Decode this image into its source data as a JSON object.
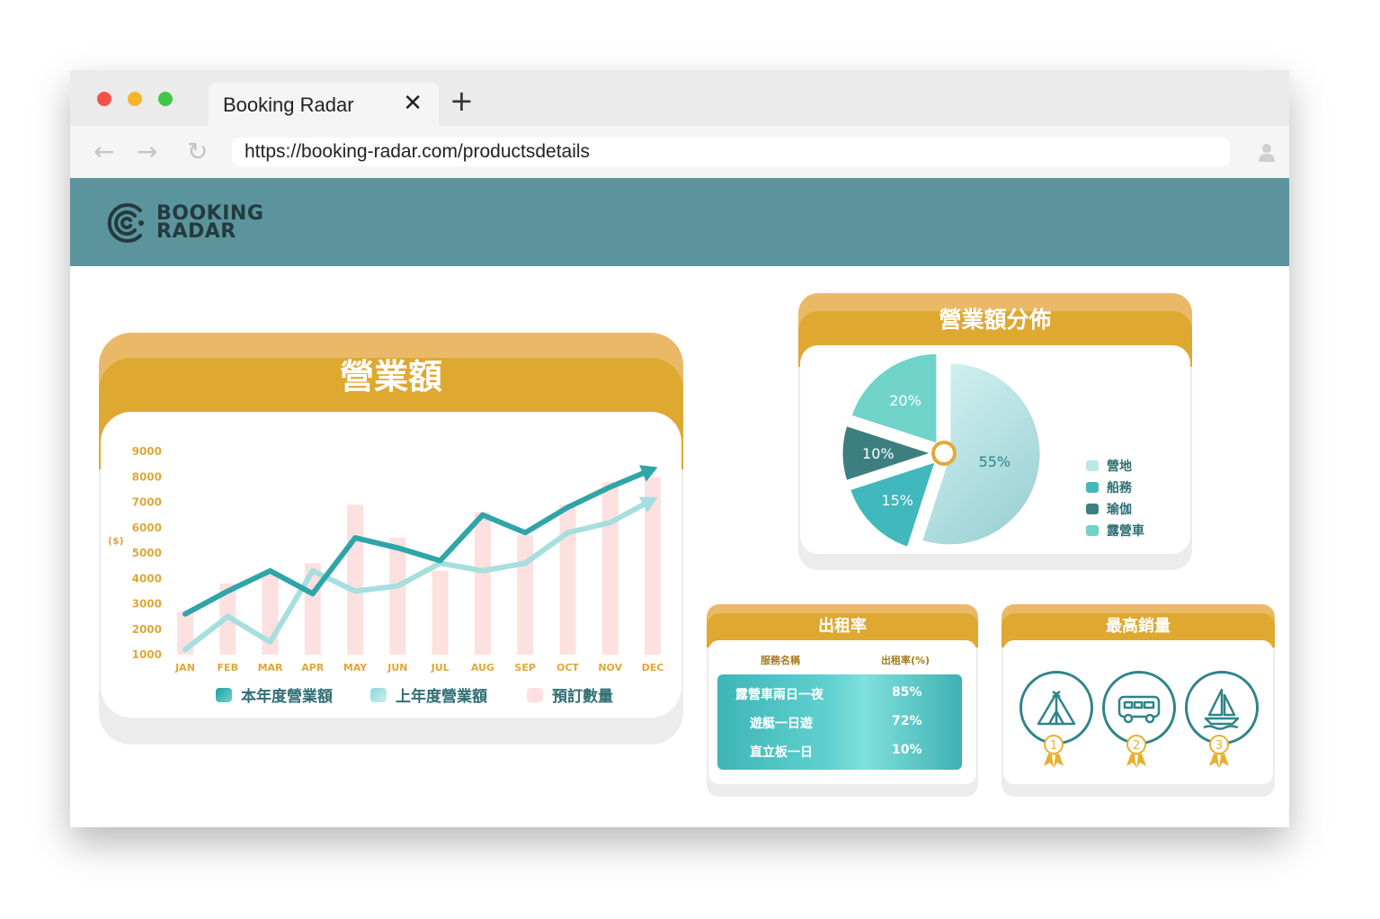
{
  "browser": {
    "tab_title": "Booking Radar",
    "url": "https://booking-radar.com/productsdetails"
  },
  "header": {
    "logo_line1": "BOOKING",
    "logo_line2": "RADAR"
  },
  "revenue": {
    "title": "營業額",
    "y_unit": "($)",
    "legend": {
      "this_year": "本年度營業額",
      "last_year": "上年度營業額",
      "bookings": "預訂數量"
    }
  },
  "distribution": {
    "title": "營業額分佈",
    "legend": [
      "營地",
      "船務",
      "瑜伽",
      "露營車"
    ]
  },
  "occupancy": {
    "title": "出租率",
    "col_name": "服務名稱",
    "col_rate": "出租率(%)",
    "rows": [
      {
        "name": "露營車兩日一夜",
        "rate": "85%"
      },
      {
        "name": "遊艇一日遊",
        "rate": "72%"
      },
      {
        "name": "直立板一日",
        "rate": "10%"
      }
    ]
  },
  "top_sales": {
    "title": "最高銷量",
    "ranks": [
      "1",
      "2",
      "3"
    ],
    "icons": [
      "tent-icon",
      "bus-icon",
      "sailboat-icon"
    ]
  },
  "chart_data": [
    {
      "type": "line",
      "title": "營業額",
      "ylabel": "($)",
      "ylim": [
        0,
        9000
      ],
      "yticks": [
        1000,
        2000,
        3000,
        4000,
        5000,
        6000,
        7000,
        8000,
        9000
      ],
      "categories": [
        "JAN",
        "FEB",
        "MAR",
        "APR",
        "MAY",
        "JUN",
        "JUL",
        "AUG",
        "SEP",
        "OCT",
        "NOV",
        "DEC"
      ],
      "series": [
        {
          "name": "本年度營業額",
          "type": "line",
          "color": "#2fa5a8",
          "values": [
            2600,
            3500,
            4300,
            3400,
            5600,
            5200,
            4700,
            6500,
            5800,
            6800,
            7600,
            8300
          ]
        },
        {
          "name": "上年度營業額",
          "type": "line",
          "color": "#a5dfde",
          "values": [
            1200,
            2500,
            1500,
            4300,
            3500,
            3700,
            4600,
            4300,
            4600,
            5800,
            6200,
            7100
          ]
        },
        {
          "name": "預訂數量",
          "type": "bar",
          "color": "#fde0e0",
          "values": [
            2700,
            3800,
            4200,
            4600,
            6900,
            5600,
            4300,
            6600,
            5700,
            6900,
            7800,
            8000
          ]
        }
      ],
      "grid": false,
      "legend_position": "bottom"
    },
    {
      "type": "pie",
      "title": "營業額分佈",
      "labels": [
        "營地",
        "船務",
        "瑜伽",
        "露營車"
      ],
      "values": [
        55,
        15,
        10,
        20
      ],
      "value_labels": [
        "55%",
        "15%",
        "10%",
        "20%"
      ],
      "colors": [
        "#b8e8e7",
        "#40b8bc",
        "#3d7f81",
        "#6fd3c9"
      ],
      "legend_position": "right"
    }
  ],
  "colors": {
    "teal_header": "#5b949c",
    "card_gold": "#dea831",
    "card_gold_light": "#eab967",
    "accent_teal": "#2fa5a8"
  }
}
